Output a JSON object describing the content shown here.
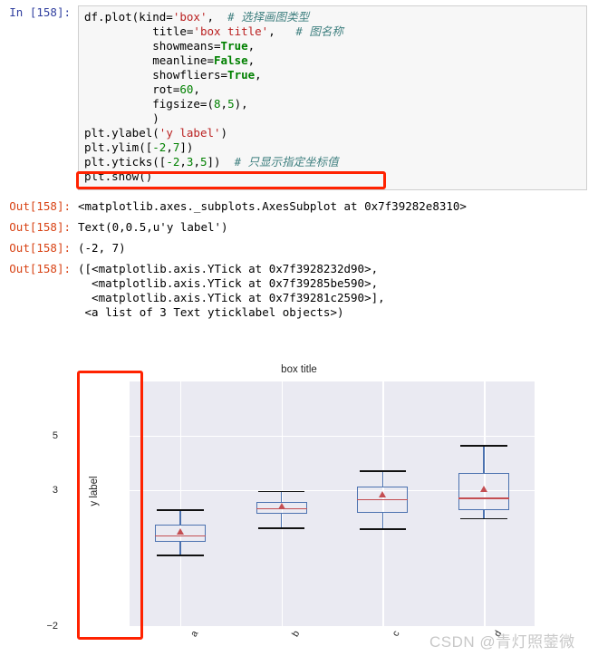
{
  "notebook": {
    "input_prompt": "In [158]:",
    "code_lines": [
      [
        {
          "t": "df.plot(kind=",
          "c": "plain"
        },
        {
          "t": "'box'",
          "c": "s-str"
        },
        {
          "t": ",  ",
          "c": "plain"
        },
        {
          "t": "# 选择画图类型",
          "c": "s-cmt"
        }
      ],
      [
        {
          "t": "          title=",
          "c": "plain"
        },
        {
          "t": "'box title'",
          "c": "s-str"
        },
        {
          "t": ",   ",
          "c": "plain"
        },
        {
          "t": "# 图名称",
          "c": "s-cmt"
        }
      ],
      [
        {
          "t": "          showmeans=",
          "c": "plain"
        },
        {
          "t": "True",
          "c": "s-kw"
        },
        {
          "t": ",",
          "c": "plain"
        }
      ],
      [
        {
          "t": "          meanline=",
          "c": "plain"
        },
        {
          "t": "False",
          "c": "s-kw"
        },
        {
          "t": ",",
          "c": "plain"
        }
      ],
      [
        {
          "t": "          showfliers=",
          "c": "plain"
        },
        {
          "t": "True",
          "c": "s-kw"
        },
        {
          "t": ",",
          "c": "plain"
        }
      ],
      [
        {
          "t": "          rot=",
          "c": "plain"
        },
        {
          "t": "60",
          "c": "s-num"
        },
        {
          "t": ",",
          "c": "plain"
        }
      ],
      [
        {
          "t": "          figsize=(",
          "c": "plain"
        },
        {
          "t": "8",
          "c": "s-num"
        },
        {
          "t": ",",
          "c": "plain"
        },
        {
          "t": "5",
          "c": "s-num"
        },
        {
          "t": "),",
          "c": "plain"
        }
      ],
      [
        {
          "t": "          )",
          "c": "plain"
        }
      ],
      [
        {
          "t": "plt.ylabel(",
          "c": "plain"
        },
        {
          "t": "'y label'",
          "c": "s-str"
        },
        {
          "t": ")",
          "c": "plain"
        }
      ],
      [
        {
          "t": "plt.ylim([",
          "c": "plain"
        },
        {
          "t": "-2",
          "c": "s-num"
        },
        {
          "t": ",",
          "c": "plain"
        },
        {
          "t": "7",
          "c": "s-num"
        },
        {
          "t": "])",
          "c": "plain"
        }
      ],
      [
        {
          "t": "plt.yticks([",
          "c": "plain"
        },
        {
          "t": "-2",
          "c": "s-num"
        },
        {
          "t": ",",
          "c": "plain"
        },
        {
          "t": "3",
          "c": "s-num"
        },
        {
          "t": ",",
          "c": "plain"
        },
        {
          "t": "5",
          "c": "s-num"
        },
        {
          "t": "])  ",
          "c": "plain"
        },
        {
          "t": "# 只显示指定坐标值",
          "c": "s-cmt"
        }
      ],
      [
        {
          "t": "plt.show()",
          "c": "plain"
        }
      ]
    ],
    "outputs": [
      {
        "prompt": "Out[158]:",
        "text": "<matplotlib.axes._subplots.AxesSubplot at 0x7f39282e8310>"
      },
      {
        "prompt": "Out[158]:",
        "text": "Text(0,0.5,u'y label')"
      },
      {
        "prompt": "Out[158]:",
        "text": "(-2, 7)"
      },
      {
        "prompt": "Out[158]:",
        "text": "([<matplotlib.axis.YTick at 0x7f3928232d90>,\n  <matplotlib.axis.YTick at 0x7f39285be590>,\n  <matplotlib.axis.YTick at 0x7f39281c2590>],\n <a list of 3 Text yticklabel objects>)"
      }
    ]
  },
  "annotations": {
    "highlight_color": "#FF2200",
    "code_highlight_target": "plt.yticks([-2,3,5])",
    "axis_highlight_target": "y-axis tick labels"
  },
  "watermark": {
    "text": "CSDN @青灯照蓥微"
  },
  "chart_data": {
    "type": "box",
    "title": "box title",
    "xlabel": "",
    "ylabel": "y label",
    "ylim": [
      -2,
      7
    ],
    "yticks": [
      -2,
      3,
      5
    ],
    "ytick_labels": [
      "−2",
      "3",
      "5"
    ],
    "xtick_rotation": 60,
    "grid": true,
    "legend": false,
    "plot_bg": "#EAEAF2",
    "box_color": "#4C72B0",
    "median_color": "#C44E52",
    "mean_marker_color": "#C44E52",
    "categories": [
      "a",
      "b",
      "c",
      "d"
    ],
    "series": [
      {
        "name": "a",
        "whisker_low": 0.62,
        "q1": 1.1,
        "median": 1.34,
        "mean": 1.48,
        "q3": 1.74,
        "whisker_high": 2.3
      },
      {
        "name": "b",
        "whisker_low": 1.62,
        "q1": 2.12,
        "median": 2.35,
        "mean": 2.4,
        "q3": 2.56,
        "whisker_high": 2.98
      },
      {
        "name": "c",
        "whisker_low": 1.6,
        "q1": 2.18,
        "median": 2.68,
        "mean": 2.85,
        "q3": 3.12,
        "whisker_high": 3.72
      },
      {
        "name": "d",
        "whisker_low": 1.98,
        "q1": 2.26,
        "median": 2.73,
        "mean": 3.05,
        "q3": 3.62,
        "whisker_high": 4.66
      }
    ]
  }
}
